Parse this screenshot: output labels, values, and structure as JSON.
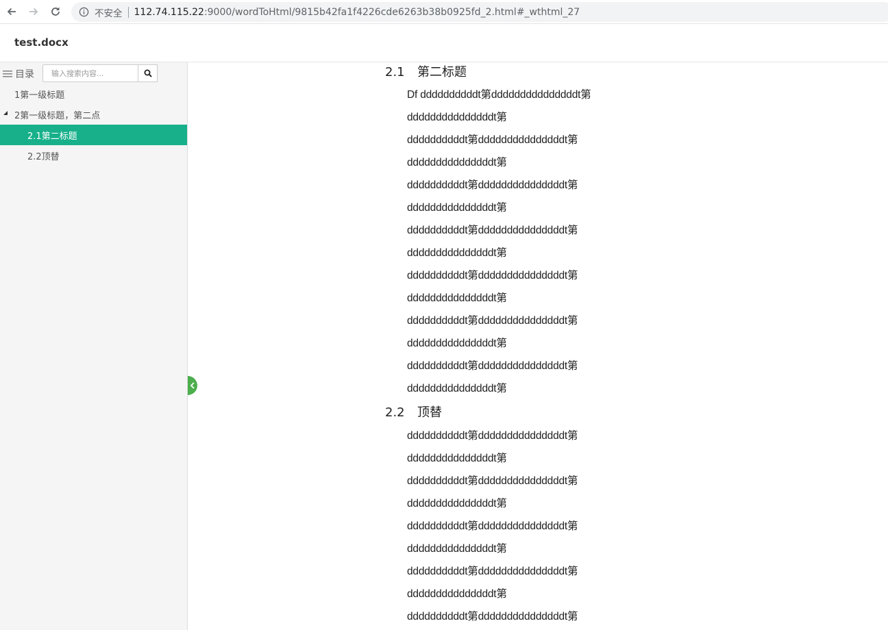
{
  "browser": {
    "insecure_label": "不安全",
    "url_host": "112.74.115.22",
    "url_path": ":9000/wordToHtml/9815b42fa1f4226cde6263b38b0925fd_2.html#_wthtml_27"
  },
  "header": {
    "doc_title": "test.docx"
  },
  "sidebar": {
    "toc_label": "目录",
    "search_placeholder": "输入搜索内容...",
    "items": [
      {
        "label": "1第一级标题"
      },
      {
        "label": "2第一级标题，第二点"
      },
      {
        "label": "2.1第二标题"
      },
      {
        "label": "2.2顶替"
      }
    ]
  },
  "document": {
    "sections": [
      {
        "num": "2.1",
        "title": "第二标题",
        "lines": [
          "Df ddddddddddt第dddddddddddddddt第",
          "dddddddddddddddt第",
          "ddddddddddt第dddddddddddddddt第",
          "dddddddddddddddt第",
          "ddddddddddt第dddddddddddddddt第",
          "dddddddddddddddt第",
          "ddddddddddt第dddddddddddddddt第",
          "dddddddddddddddt第",
          "ddddddddddt第dddddddddddddddt第",
          "dddddddddddddddt第",
          "ddddddddddt第dddddddddddddddt第",
          "dddddddddddddddt第",
          "ddddddddddt第dddddddddddddddt第",
          "dddddddddddddddt第"
        ]
      },
      {
        "num": "2.2",
        "title": "顶替",
        "lines": [
          "ddddddddddt第dddddddddddddddt第",
          "dddddddddddddddt第",
          "ddddddddddt第dddddddddddddddt第",
          "dddddddddddddddt第",
          "ddddddddddt第dddddddddddddddt第",
          "dddddddddddddddt第",
          "ddddddddddt第dddddddddddddddt第",
          "dddddddddddddddt第",
          "ddddddddddt第dddddddddddddddt第"
        ]
      }
    ]
  },
  "colors": {
    "active_toc": "#17b08a",
    "collapse_tab": "#4cae4c"
  }
}
